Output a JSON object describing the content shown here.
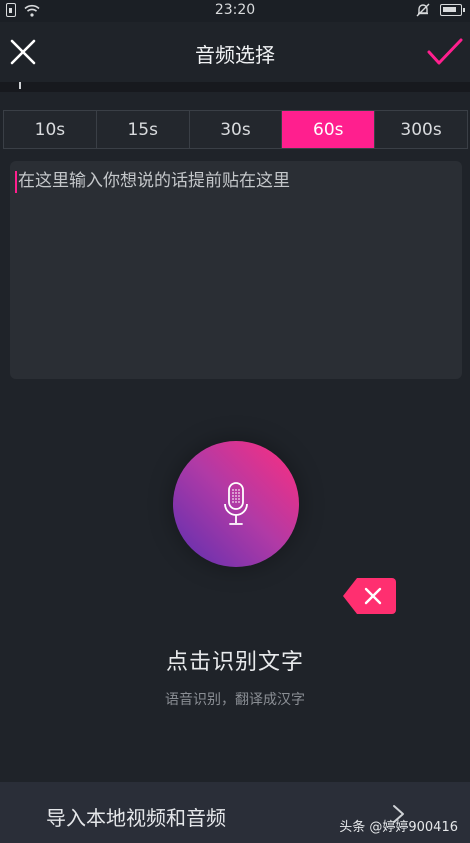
{
  "status_bar": {
    "time": "23:20",
    "icons": [
      "sim-icon",
      "wifi-icon",
      "mute-bell-icon",
      "battery-icon"
    ]
  },
  "header": {
    "title": "音频选择",
    "close_icon": "close-icon",
    "confirm_icon": "check-icon",
    "accent_color": "#ff1f8e"
  },
  "duration_tabs": {
    "options": [
      "10s",
      "15s",
      "30s",
      "60s",
      "300s"
    ],
    "selected": "60s"
  },
  "text_input": {
    "placeholder": "在这里输入你想说的话提前贴在这里"
  },
  "mic": {
    "icon": "microphone-icon"
  },
  "clear": {
    "icon": "close-icon"
  },
  "hint": {
    "title": "点击识别文字",
    "subtitle": "语音识别，翻译成汉字"
  },
  "import": {
    "label": "导入本地视频和音频",
    "icon": "chevron-right-icon"
  },
  "watermark": {
    "text": "头条 @婷婷900416"
  },
  "colors": {
    "background": "#1f2329",
    "accent": "#ff1f8e",
    "panel": "#2a2e34"
  }
}
